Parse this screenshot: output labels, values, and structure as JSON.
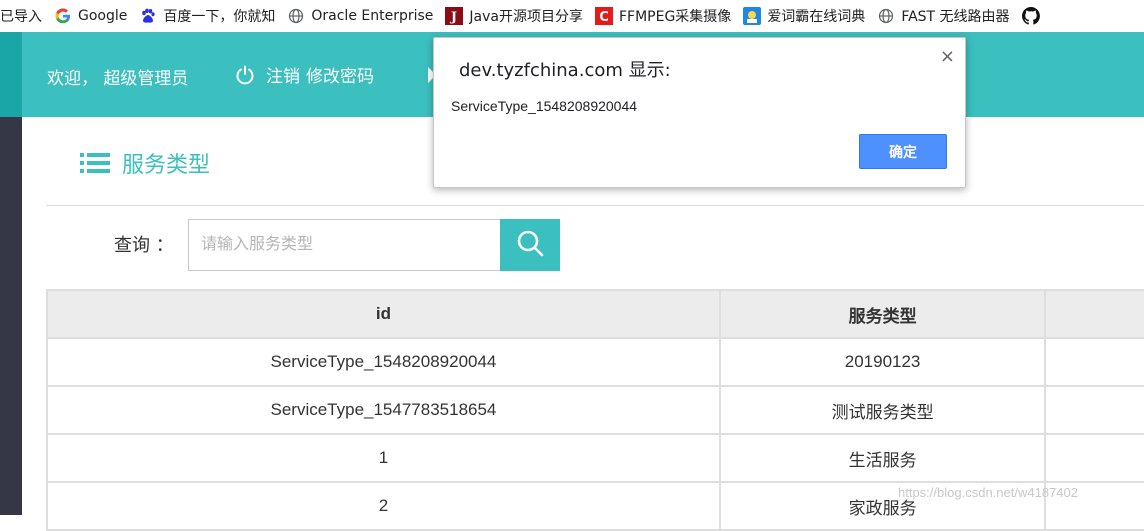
{
  "bookmarks": [
    {
      "label": "已导入",
      "icon": "none"
    },
    {
      "label": "Google",
      "icon": "google-icon"
    },
    {
      "label": "百度一下，你就知",
      "icon": "baidu-paw-icon"
    },
    {
      "label": "Oracle Enterprise",
      "icon": "globe-icon"
    },
    {
      "label": "Java开源项目分享",
      "icon": "j-logo-icon"
    },
    {
      "label": "FFMPEG采集摄像",
      "icon": "red-c-icon"
    },
    {
      "label": "爱词霸在线词典",
      "icon": "iciba-icon"
    },
    {
      "label": "FAST 无线路由器",
      "icon": "globe-icon"
    }
  ],
  "header": {
    "welcome": "欢迎，  超级管理员",
    "logout": "注销",
    "change_password": "修改密码"
  },
  "page": {
    "title": "服务类型"
  },
  "search": {
    "label": "查询 ：",
    "placeholder": "请输入服务类型"
  },
  "table": {
    "headers": [
      "id",
      "服务类型"
    ],
    "rows": [
      [
        "ServiceType_1548208920044",
        "20190123"
      ],
      [
        "ServiceType_1547783518654",
        "测试服务类型"
      ],
      [
        "1",
        "生活服务"
      ],
      [
        "2",
        "家政服务"
      ]
    ]
  },
  "dialog": {
    "title": "dev.tyzfchina.com 显示:",
    "message": "ServiceType_1548208920044",
    "ok_label": "确定",
    "close_symbol": "×"
  },
  "watermark": "https://blog.csdn.net/w4187402",
  "colors": {
    "teal": "#3bbfbf",
    "dark_teal": "#1aa6a6",
    "sidebar": "#353646",
    "dialog_button": "#4d90fe"
  }
}
